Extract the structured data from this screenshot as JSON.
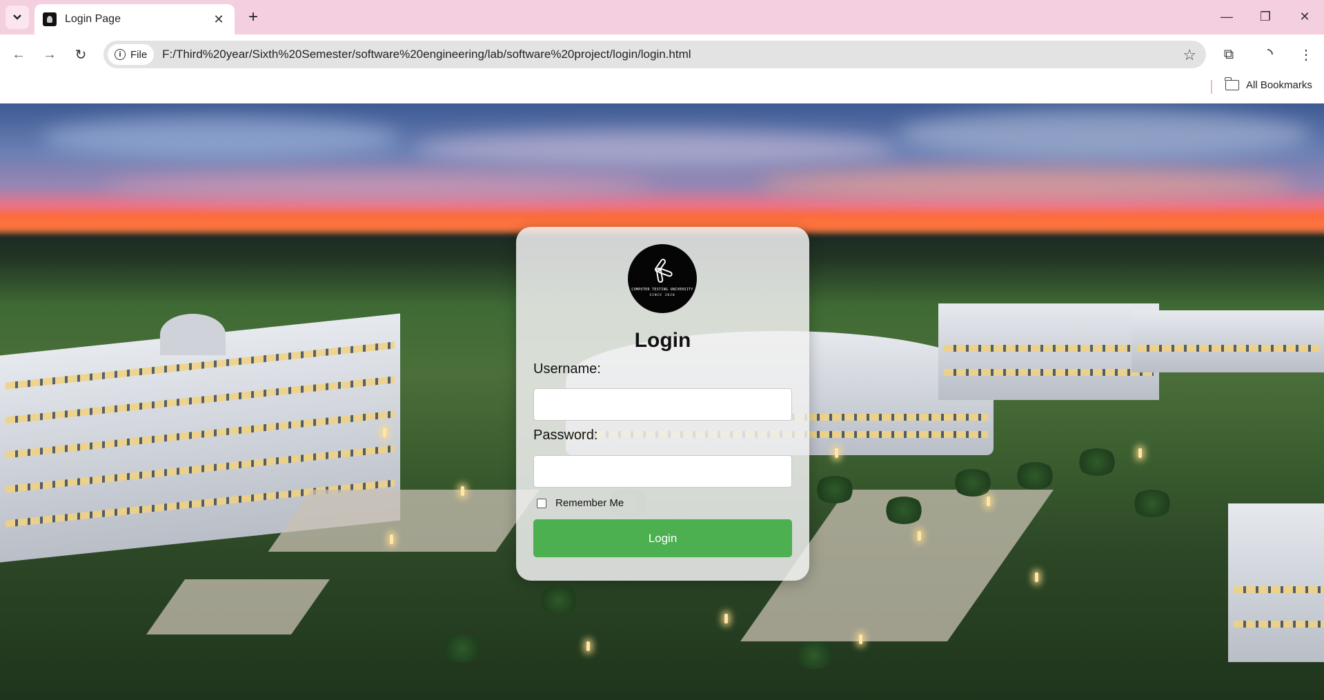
{
  "browser": {
    "tab": {
      "title": "Login Page",
      "close_glyph": "✕"
    },
    "new_tab_glyph": "+",
    "window_controls": {
      "minimize": "—",
      "restore": "❐",
      "close": "✕"
    },
    "nav": {
      "back": "←",
      "forward": "→",
      "reload": "↻"
    },
    "omnibox": {
      "chip_label": "File",
      "url": "F:/Third%20year/Sixth%20Semester/software%20engineering/lab/software%20project/login/login.html"
    },
    "bookmarks": {
      "all_label": "All Bookmarks"
    },
    "icons": {
      "star": "☆",
      "extensions": "⧉",
      "menu": "⋮"
    }
  },
  "login": {
    "logo": {
      "text": "COMPUTER TESTING UNIVERSITY",
      "subtext": "SINCE 2020"
    },
    "title": "Login",
    "username_label": "Username:",
    "username_value": "",
    "password_label": "Password:",
    "password_value": "",
    "remember_label": "Remember Me",
    "remember_checked": false,
    "button_label": "Login"
  },
  "colors": {
    "tabstrip": "#f4cfe0",
    "login_button": "#4caf50",
    "card": "#f0f0f0"
  }
}
